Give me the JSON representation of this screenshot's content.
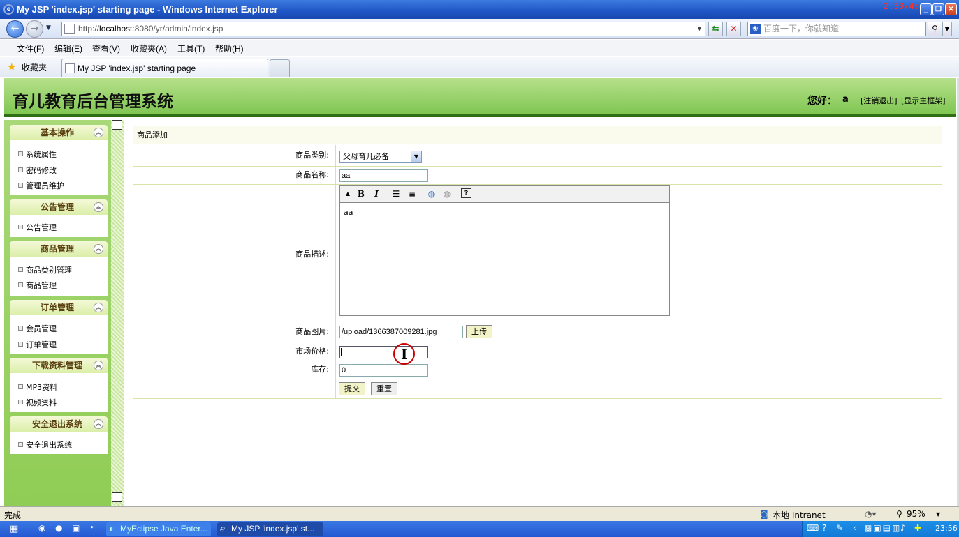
{
  "window": {
    "title": "My JSP 'index.jsp' starting page - Windows Internet Explorer",
    "clock": "2:33/4:4"
  },
  "browser": {
    "address_prefix": "http://",
    "address_host": "localhost",
    "address_rest": ":8080/yr/admin/index.jsp",
    "search_placeholder": "百度一下，你就知道",
    "menu": [
      "文件(F)",
      "编辑(E)",
      "查看(V)",
      "收藏夹(A)",
      "工具(T)",
      "帮助(H)"
    ],
    "favorites_label": "收藏夹",
    "tab_title": "My JSP 'index.jsp' starting page"
  },
  "header": {
    "title": "育儿教育后台管理系统",
    "greeting": "您好：",
    "user": "a",
    "logout": "[注销退出]",
    "show_frame": "[显示主框架]"
  },
  "sidebar": {
    "groups": [
      {
        "title": "基本操作",
        "items": [
          "系统属性",
          "密码修改",
          "管理员维护"
        ]
      },
      {
        "title": "公告管理",
        "items": [
          "公告管理"
        ]
      },
      {
        "title": "商品管理",
        "items": [
          "商品类别管理",
          "商品管理"
        ]
      },
      {
        "title": "订单管理",
        "items": [
          "会员管理",
          "订单管理"
        ]
      },
      {
        "title": "下载资料管理",
        "items": [
          "MP3资料",
          "视频资料"
        ]
      },
      {
        "title": "安全退出系统",
        "items": [
          "安全退出系统"
        ]
      }
    ]
  },
  "form": {
    "title": "商品添加",
    "category_label": "商品类别:",
    "category_value": "父母育儿必备",
    "name_label": "商品名称:",
    "name_value": "aa",
    "desc_label": "商品描述:",
    "desc_value": "aa",
    "image_label": "商品图片:",
    "image_value": "/upload/1366387009281.jpg",
    "upload_btn": "上传",
    "price_label": "市场价格:",
    "price_value": "",
    "stock_label": "库存:",
    "stock_value": "0",
    "submit_btn": "提交",
    "reset_btn": "重置"
  },
  "status": {
    "text": "完成",
    "zone": "本地 Intranet",
    "zoom": "95%"
  },
  "taskbar": {
    "task1": "MyEclipse Java Enter...",
    "task2": "My JSP 'index.jsp' st...",
    "time": "23:56"
  }
}
